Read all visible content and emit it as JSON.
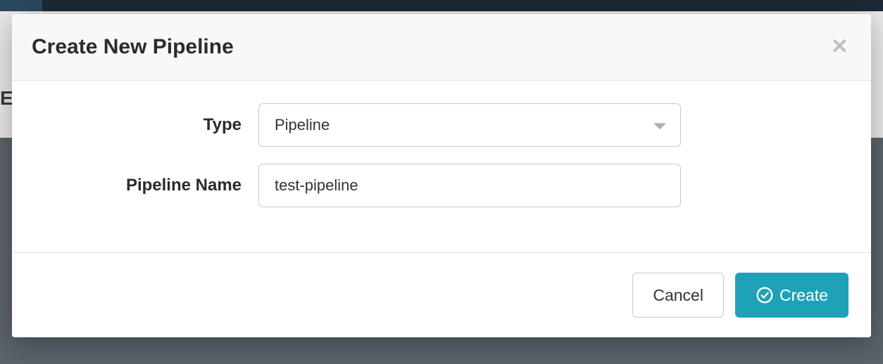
{
  "backdrop": {
    "page_fragment": "ES"
  },
  "modal": {
    "title": "Create New Pipeline",
    "fields": {
      "type": {
        "label": "Type",
        "value": "Pipeline"
      },
      "name": {
        "label": "Pipeline Name",
        "value": "test-pipeline"
      }
    },
    "buttons": {
      "cancel": "Cancel",
      "create": "Create"
    }
  },
  "colors": {
    "primary": "#1fa2b8"
  }
}
